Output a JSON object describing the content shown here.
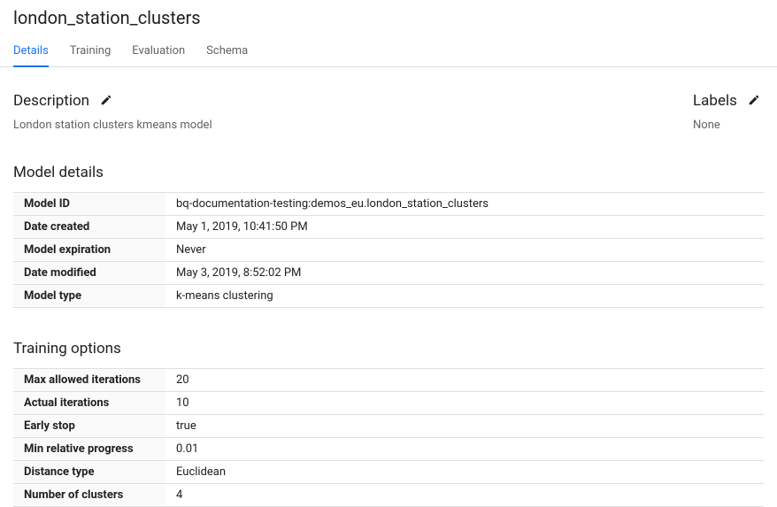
{
  "header": {
    "title": "london_station_clusters"
  },
  "tabs": {
    "details": "Details",
    "training": "Training",
    "evaluation": "Evaluation",
    "schema": "Schema"
  },
  "description": {
    "heading": "Description",
    "text": "London station clusters kmeans model"
  },
  "labels": {
    "heading": "Labels",
    "value": "None"
  },
  "model_details": {
    "heading": "Model details",
    "rows": [
      {
        "k": "Model ID",
        "v": "bq-documentation-testing:demos_eu.london_station_clusters"
      },
      {
        "k": "Date created",
        "v": "May 1, 2019, 10:41:50 PM"
      },
      {
        "k": "Model expiration",
        "v": "Never"
      },
      {
        "k": "Date modified",
        "v": "May 3, 2019, 8:52:02 PM"
      },
      {
        "k": "Model type",
        "v": "k-means clustering"
      }
    ]
  },
  "training_options": {
    "heading": "Training options",
    "rows": [
      {
        "k": "Max allowed iterations",
        "v": "20"
      },
      {
        "k": "Actual iterations",
        "v": "10"
      },
      {
        "k": "Early stop",
        "v": "true"
      },
      {
        "k": "Min relative progress",
        "v": "0.01"
      },
      {
        "k": "Distance type",
        "v": "Euclidean"
      },
      {
        "k": "Number of clusters",
        "v": "4"
      }
    ]
  }
}
